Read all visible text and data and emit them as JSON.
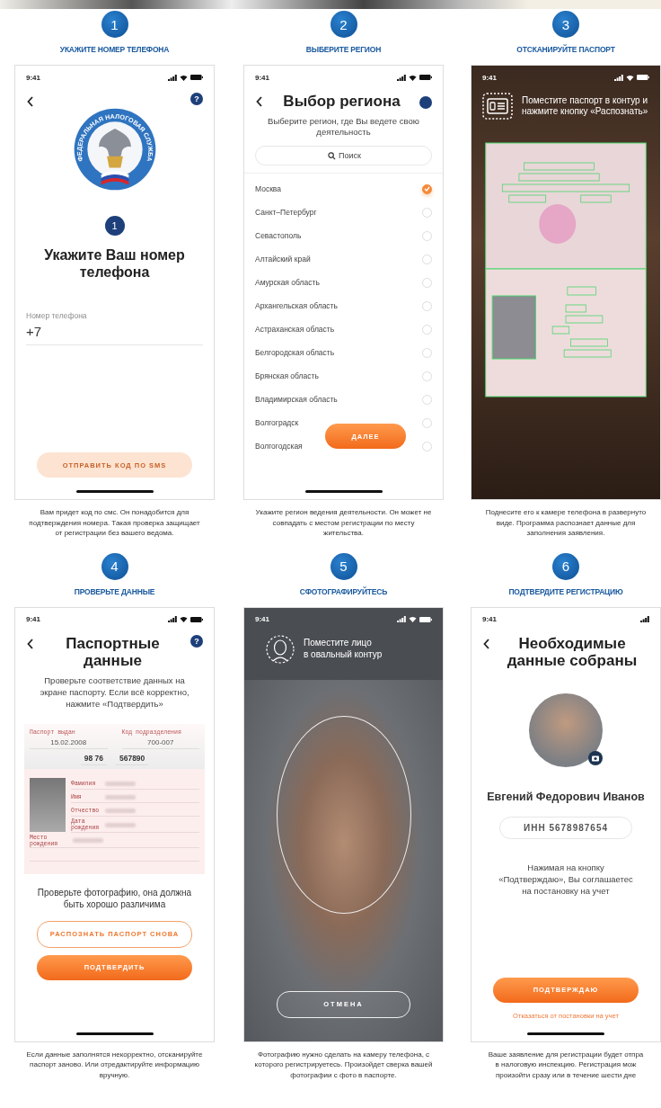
{
  "steps": [
    {
      "number": "1",
      "title": "УКАЖИТЕ НОМЕР ТЕЛЕФОНА",
      "caption": "Вам придет код по смс. Он понадобится для\nподтверждения номера. Такая проверка защищает\nот регистрации без вашего ведома.",
      "screen": {
        "kind": "phone",
        "time": "9:41",
        "help": "?",
        "emblem_text": "ФЕДЕРАЛЬНАЯ НАЛОГОВАЯ СЛУЖБА",
        "step_badge": "1",
        "heading": "Укажите Ваш номер телефона",
        "field_label": "Номер телефона",
        "field_value": "+7",
        "button": {
          "label": "ОТПРАВИТЬ КОД ПО SMS",
          "disabled": true
        }
      }
    },
    {
      "number": "2",
      "title": "ВЫБЕРИТЕ РЕГИОН",
      "caption": "Укажите регион ведения деятельности. Он может не\nсовпадать с местом регистрации по месту\nжительства.",
      "screen": {
        "kind": "region_list",
        "time": "9:41",
        "title": "Выбор региона",
        "subtitle": "Выберите регион, где Вы ведете свою деятельность",
        "search_placeholder": "Поиск",
        "regions": [
          {
            "name": "Москва",
            "selected": true
          },
          {
            "name": "Санкт–Петербург",
            "selected": false
          },
          {
            "name": "Севастополь",
            "selected": false
          },
          {
            "name": "Алтайский край",
            "selected": false
          },
          {
            "name": "Амурская область",
            "selected": false
          },
          {
            "name": "Архангельская область",
            "selected": false
          },
          {
            "name": "Астраханская область",
            "selected": false
          },
          {
            "name": "Белгородская область",
            "selected": false
          },
          {
            "name": "Брянская область",
            "selected": false
          },
          {
            "name": "Владимирская область",
            "selected": false
          },
          {
            "name": "Волгоградск",
            "selected": false
          },
          {
            "name": "Волгогодская",
            "selected": false
          }
        ],
        "button": {
          "label": "ДАЛЕЕ",
          "disabled": false
        }
      }
    },
    {
      "number": "3",
      "title": "ОТСКАНИРУЙТЕ ПАСПОРТ",
      "caption": "Поднесите его к камере телефона в развернуто\nвиде. Программа распознает данные для\nзаполнения заявления.",
      "screen": {
        "kind": "passport_scan",
        "time": "9:41",
        "instruction": "Поместите паспорт в контур и нажмите кнопку «Распознать»"
      }
    },
    {
      "number": "4",
      "title": "ПРОВЕРЬТЕ ДАННЫЕ",
      "caption": "Если данные заполнятся некорректно, отсканируйте\nпаспорт заново. Или отредактируйте информацию\nвручную.",
      "screen": {
        "kind": "passport_data",
        "time": "9:41",
        "title": "Паспортные данные",
        "help": "?",
        "instruction": "Проверьте соответствие данных на экране паспорту. Если всё корректно, нажмите «Подтвердить»",
        "issued_label": "Паспорт выдан",
        "issued_value": "15.02.2008",
        "code_label": "Код подразделения",
        "code_value": "700-007",
        "series": "98 76",
        "number": "567890",
        "person_fields": [
          "Фамилия",
          "Имя",
          "Отчество",
          "Дата рождения",
          "Место рождения"
        ],
        "photo_note": "Проверьте фотографию, она должна быть хорошо различима",
        "buttons": [
          {
            "kind": "outline",
            "label": "РАСПОЗНАТЬ ПАСПОРТ СНОВА"
          },
          {
            "kind": "filled",
            "label": "ПОДТВЕРДИТЬ"
          }
        ]
      }
    },
    {
      "number": "5",
      "title": "СФОТОГРАФИРУЙТЕСЬ",
      "caption": "Фотографию нужно сделать на камеру телефона, с\nкоторого регистрируетесь. Произойдет сверка вашей\nфотографии с фото в паспорте.",
      "screen": {
        "kind": "face_capture",
        "time": "9:41",
        "instruction": "Поместите лицо\nв овальный контур",
        "button": "ОТМЕНА"
      }
    },
    {
      "number": "6",
      "title": "ПОДТВЕРДИТЕ РЕГИСТРАЦИЮ",
      "caption": "Ваше заявление для регистрации будет отпра\nв налоговую инспекцию. Регистрация мож\nпроизойти сразу или в течение шести дне",
      "screen": {
        "kind": "summary",
        "time": "9:41",
        "title": "Необходимые данные собраны",
        "name": "Евгений Федорович Иванов",
        "inn": "ИНН 5678987654",
        "note": "Нажимая на кнопку\n«Подтверждаю», Вы соглашаетес\nна постановку на учет",
        "button": "ПОДТВЕРЖДАЮ",
        "link": "Отказаться от постановки на учет"
      }
    }
  ]
}
